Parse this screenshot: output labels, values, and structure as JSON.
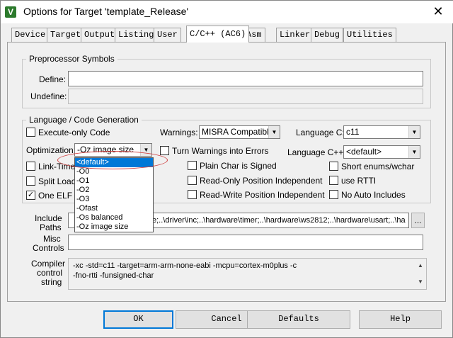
{
  "window": {
    "title": "Options for Target 'template_Release'",
    "icon": "keil-uvision-icon",
    "close_glyph": "✕",
    "title_icon_glyph": "V"
  },
  "tabs": [
    "Device",
    "Target",
    "Output",
    "Listing",
    "User",
    "C/C++ (AC6)",
    "Asm",
    "Linker",
    "Debug",
    "Utilities"
  ],
  "active_tab": "C/C++ (AC6)",
  "preprocessor": {
    "title": "Preprocessor Symbols",
    "define_label": "Define:",
    "define_value": "",
    "undefine_label": "Undefine:",
    "undefine_value": ""
  },
  "language": {
    "title": "Language / Code Generation",
    "execute_only": {
      "label": "Execute-only Code",
      "checked": false
    },
    "optimization_label": "Optimization:",
    "optimization_value": "-Oz image size",
    "turn_warnings": {
      "label": "Turn Warnings into Errors",
      "checked": false
    },
    "link_time": {
      "label": "Link-Time Optimization",
      "visible_text": "Link-Time",
      "checked": false
    },
    "split_load": {
      "label": "Split Load and Store Multiple",
      "visible_text": "Split Load",
      "checked": false
    },
    "one_elf": {
      "label": "One ELF Section per Function",
      "visible_text": "One ELF S",
      "checked": true
    },
    "warnings_label": "Warnings:",
    "warnings_value": "MISRA Compatible",
    "plain_char": {
      "label": "Plain Char is Signed",
      "checked": false
    },
    "ropi": {
      "label": "Read-Only Position Independent",
      "checked": false
    },
    "rwpi": {
      "label": "Read-Write Position Independent",
      "checked": false
    },
    "language_c_label": "Language C:",
    "language_c_value": "c11",
    "language_cpp_label": "Language C++:",
    "language_cpp_value": "<default>",
    "short_enums": {
      "label": "Short enums/wchar",
      "checked": false
    },
    "use_rtti": {
      "label": "use RTTI",
      "checked": false
    },
    "no_auto_includes": {
      "label": "No Auto Includes",
      "checked": false
    }
  },
  "optimization_options": [
    "<default>",
    "-O0",
    "-O1",
    "-O2",
    "-O3",
    "-Ofast",
    "-Os balanced",
    "-Oz image size"
  ],
  "optimization_highlighted": "<default>",
  "include_paths": {
    "label_line1": "Include",
    "label_line2": "Paths",
    "value": "...\\inc;...\\driver\\inc;..\\hardware\\timer;..\\hardware\\ws2812;..\\hardware\\usart;..\\ha",
    "visible_value": "e;..\\driver\\inc;..\\hardware\\timer;..\\hardware\\ws2812;..\\hardware\\usart;..\\ha",
    "browse_label": "..."
  },
  "misc": {
    "label_line1": "Misc",
    "label_line2": "Controls",
    "value": ""
  },
  "compiler": {
    "label_line1": "Compiler",
    "label_line2": "control",
    "label_line3": "string",
    "line1": "-xc -std=c11 -target=arm-arm-none-eabi -mcpu=cortex-m0plus -c",
    "line2": "-fno-rtti -funsigned-char"
  },
  "buttons": {
    "ok": "OK",
    "cancel": "Cancel",
    "defaults": "Defaults",
    "help": "Help"
  },
  "colors": {
    "selection": "#0078d7",
    "annotation": "#d04040",
    "dialog_bg": "#f0f0f0"
  }
}
